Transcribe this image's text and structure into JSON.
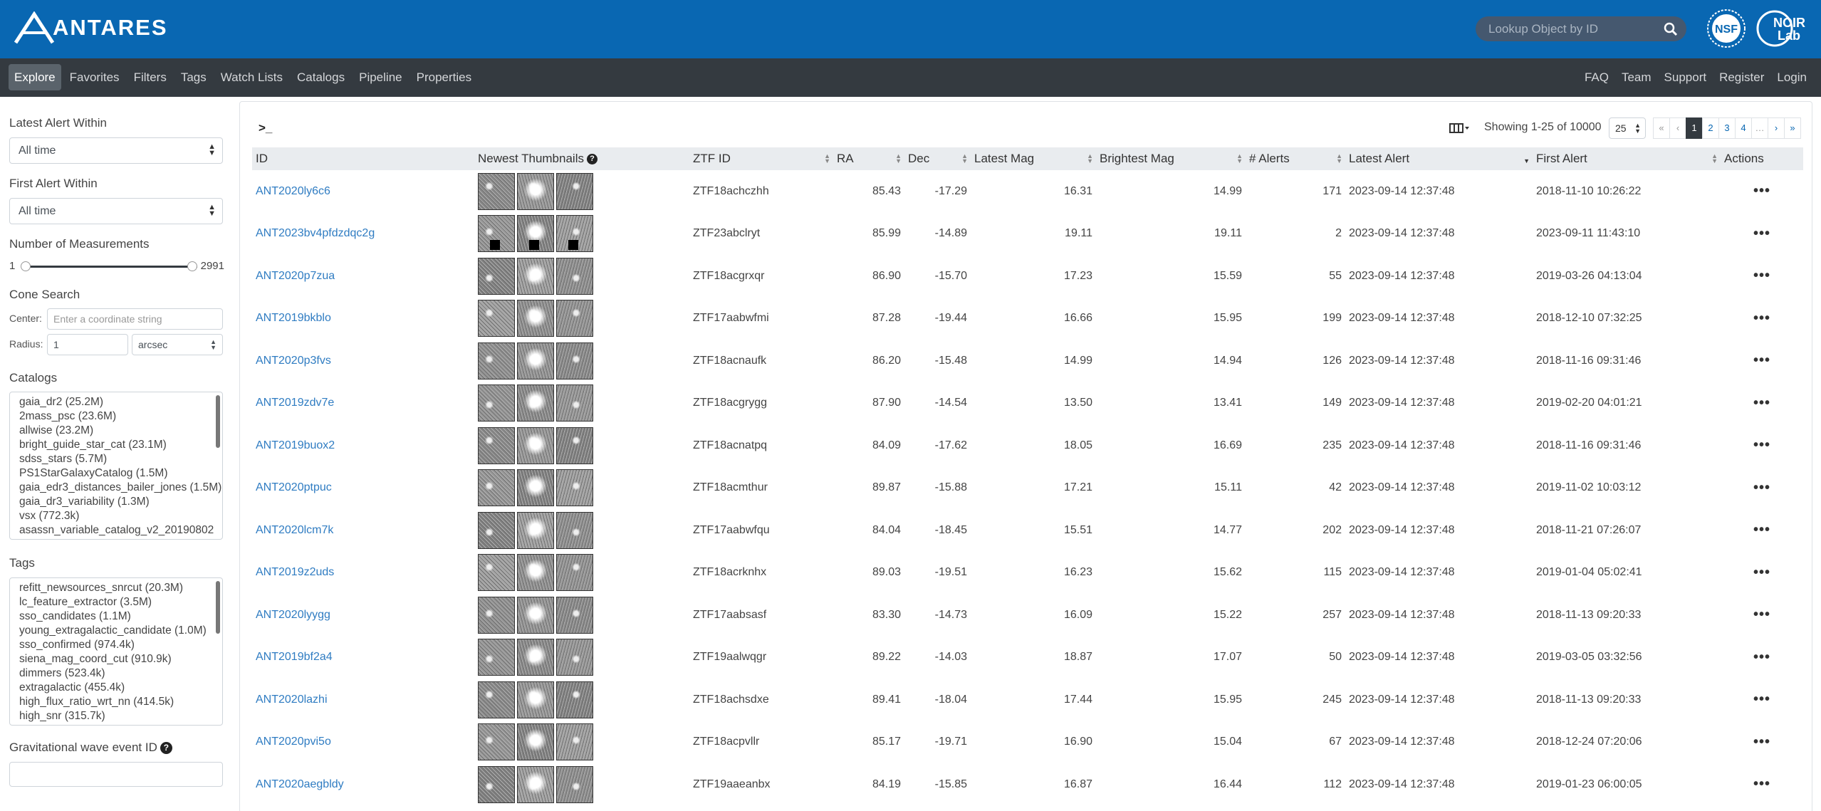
{
  "header": {
    "logo_text": "ANTARES",
    "search_placeholder": "Lookup Object by ID",
    "colors": {
      "topbar": "#0967b2",
      "navbar": "#343a40",
      "link": "#2f7cc2"
    }
  },
  "nav": {
    "left": [
      "Explore",
      "Favorites",
      "Filters",
      "Tags",
      "Watch Lists",
      "Catalogs",
      "Pipeline",
      "Properties"
    ],
    "right": [
      "FAQ",
      "Team",
      "Support",
      "Register",
      "Login"
    ],
    "active": "Explore"
  },
  "sidebar": {
    "latest_alert_label": "Latest Alert Within",
    "latest_alert_value": "All time",
    "first_alert_label": "First Alert Within",
    "first_alert_value": "All time",
    "measurements_label": "Number of Measurements",
    "measurements_min": "1",
    "measurements_max": "2991",
    "cone_label": "Cone Search",
    "center_label": "Center:",
    "center_placeholder": "Enter a coordinate string",
    "radius_label": "Radius:",
    "radius_value": "1",
    "radius_unit": "arcsec",
    "catalogs_label": "Catalogs",
    "catalogs": [
      "gaia_dr2 (25.2M)",
      "2mass_psc (23.6M)",
      "allwise (23.2M)",
      "bright_guide_star_cat (23.1M)",
      "sdss_stars (5.7M)",
      "PS1StarGalaxyCatalog (1.5M)",
      "gaia_edr3_distances_bailer_jones (1.5M)",
      "gaia_dr3_variability (1.3M)",
      "vsx (772.3k)",
      "asassn_variable_catalog_v2_20190802"
    ],
    "tags_label": "Tags",
    "tags": [
      "refitt_newsources_snrcut (20.3M)",
      "lc_feature_extractor (3.5M)",
      "sso_candidates (1.1M)",
      "young_extragalactic_candidate (1.0M)",
      "sso_confirmed (974.4k)",
      "siena_mag_coord_cut (910.9k)",
      "dimmers (523.4k)",
      "extragalactic (455.4k)",
      "high_flux_ratio_wrt_nn (414.5k)",
      "high_snr (315.7k)"
    ],
    "gw_label": "Gravitational wave event ID"
  },
  "main": {
    "prompt": ">_",
    "showing": "Showing 1-25 of 10000",
    "per_page": "25",
    "pager": [
      "«",
      "‹",
      "1",
      "2",
      "3",
      "4",
      "…",
      "›",
      "»"
    ],
    "columns": [
      "ID",
      "Newest Thumbnails",
      "ZTF ID",
      "RA",
      "Dec",
      "Latest Mag",
      "Brightest Mag",
      "# Alerts",
      "Latest Alert",
      "First Alert",
      "Actions"
    ],
    "rows": [
      {
        "id": "ANT2020ly6c6",
        "ztf": "ZTF18achczhh",
        "ra": "85.43",
        "dec": "-17.29",
        "latest": "16.31",
        "brightest": "14.99",
        "alerts": "171",
        "latest_alert": "2023-09-14 12:37:48",
        "first_alert": "2018-11-10 10:26:22"
      },
      {
        "id": "ANT2023bv4pfdzdqc2g",
        "ztf": "ZTF23abclryt",
        "ra": "85.99",
        "dec": "-14.89",
        "latest": "19.11",
        "brightest": "19.11",
        "alerts": "2",
        "latest_alert": "2023-09-14 12:37:48",
        "first_alert": "2023-09-11 11:43:10"
      },
      {
        "id": "ANT2020p7zua",
        "ztf": "ZTF18acgrxqr",
        "ra": "86.90",
        "dec": "-15.70",
        "latest": "17.23",
        "brightest": "15.59",
        "alerts": "55",
        "latest_alert": "2023-09-14 12:37:48",
        "first_alert": "2019-03-26 04:13:04"
      },
      {
        "id": "ANT2019bkblo",
        "ztf": "ZTF17aabwfmi",
        "ra": "87.28",
        "dec": "-19.44",
        "latest": "16.66",
        "brightest": "15.95",
        "alerts": "199",
        "latest_alert": "2023-09-14 12:37:48",
        "first_alert": "2018-12-10 07:32:25"
      },
      {
        "id": "ANT2020p3fvs",
        "ztf": "ZTF18acnaufk",
        "ra": "86.20",
        "dec": "-15.48",
        "latest": "14.99",
        "brightest": "14.94",
        "alerts": "126",
        "latest_alert": "2023-09-14 12:37:48",
        "first_alert": "2018-11-16 09:31:46"
      },
      {
        "id": "ANT2019zdv7e",
        "ztf": "ZTF18acgrygg",
        "ra": "87.90",
        "dec": "-14.54",
        "latest": "13.50",
        "brightest": "13.41",
        "alerts": "149",
        "latest_alert": "2023-09-14 12:37:48",
        "first_alert": "2019-02-20 04:01:21"
      },
      {
        "id": "ANT2019buox2",
        "ztf": "ZTF18acnatpq",
        "ra": "84.09",
        "dec": "-17.62",
        "latest": "18.05",
        "brightest": "16.69",
        "alerts": "235",
        "latest_alert": "2023-09-14 12:37:48",
        "first_alert": "2018-11-16 09:31:46"
      },
      {
        "id": "ANT2020ptpuc",
        "ztf": "ZTF18acmthur",
        "ra": "89.87",
        "dec": "-15.88",
        "latest": "17.21",
        "brightest": "15.11",
        "alerts": "42",
        "latest_alert": "2023-09-14 12:37:48",
        "first_alert": "2019-11-02 10:03:12"
      },
      {
        "id": "ANT2020lcm7k",
        "ztf": "ZTF17aabwfqu",
        "ra": "84.04",
        "dec": "-18.45",
        "latest": "15.51",
        "brightest": "14.77",
        "alerts": "202",
        "latest_alert": "2023-09-14 12:37:48",
        "first_alert": "2018-11-21 07:26:07"
      },
      {
        "id": "ANT2019z2uds",
        "ztf": "ZTF18acrknhx",
        "ra": "89.03",
        "dec": "-19.51",
        "latest": "16.23",
        "brightest": "15.62",
        "alerts": "115",
        "latest_alert": "2023-09-14 12:37:48",
        "first_alert": "2019-01-04 05:02:41"
      },
      {
        "id": "ANT2020lyygg",
        "ztf": "ZTF17aabsasf",
        "ra": "83.30",
        "dec": "-14.73",
        "latest": "16.09",
        "brightest": "15.22",
        "alerts": "257",
        "latest_alert": "2023-09-14 12:37:48",
        "first_alert": "2018-11-13 09:20:33"
      },
      {
        "id": "ANT2019bf2a4",
        "ztf": "ZTF19aalwqgr",
        "ra": "89.22",
        "dec": "-14.03",
        "latest": "18.87",
        "brightest": "17.07",
        "alerts": "50",
        "latest_alert": "2023-09-14 12:37:48",
        "first_alert": "2019-03-05 03:32:56"
      },
      {
        "id": "ANT2020lazhi",
        "ztf": "ZTF18achsdxe",
        "ra": "89.41",
        "dec": "-18.04",
        "latest": "17.44",
        "brightest": "15.95",
        "alerts": "245",
        "latest_alert": "2023-09-14 12:37:48",
        "first_alert": "2018-11-13 09:20:33"
      },
      {
        "id": "ANT2020pvi5o",
        "ztf": "ZTF18acpvllr",
        "ra": "85.17",
        "dec": "-19.71",
        "latest": "16.90",
        "brightest": "15.04",
        "alerts": "67",
        "latest_alert": "2023-09-14 12:37:48",
        "first_alert": "2018-12-24 07:20:06"
      },
      {
        "id": "ANT2020aegbldy",
        "ztf": "ZTF19aaeanbx",
        "ra": "84.19",
        "dec": "-15.85",
        "latest": "16.87",
        "brightest": "16.44",
        "alerts": "112",
        "latest_alert": "2023-09-14 12:37:48",
        "first_alert": "2019-01-23 06:00:05"
      }
    ],
    "actions_glyph": "•••"
  }
}
